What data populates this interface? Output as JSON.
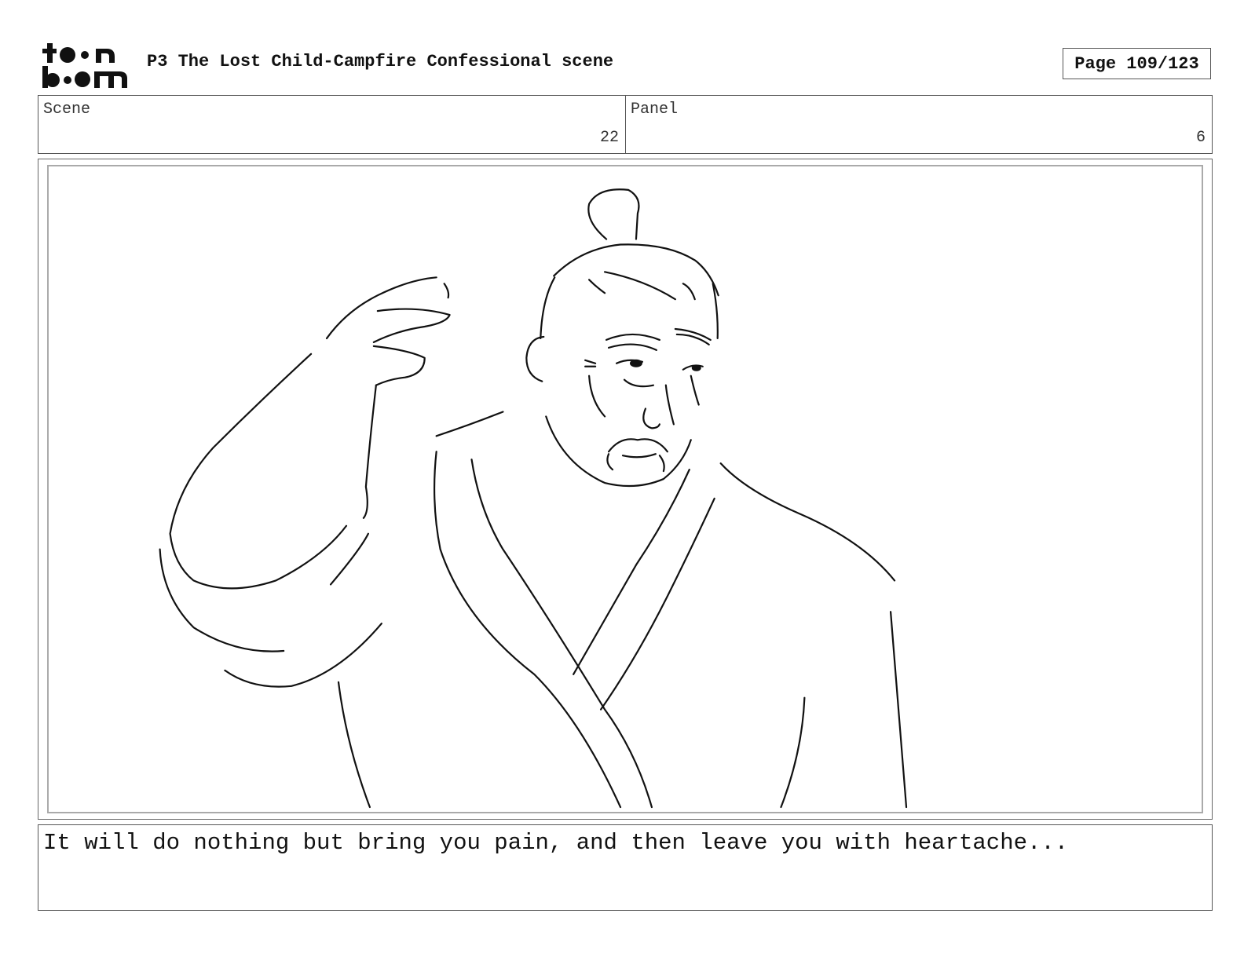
{
  "header": {
    "logo_text": "toon boom",
    "title": "P3 The Lost Child-Campfire Confessional scene",
    "page_label": "Page 109/123"
  },
  "info": {
    "scene_label": "Scene",
    "scene_value": "22",
    "panel_label": "Panel",
    "panel_value": "6"
  },
  "dialogue": {
    "text": "It will do nothing but bring you pain, and then leave you with heartache..."
  }
}
